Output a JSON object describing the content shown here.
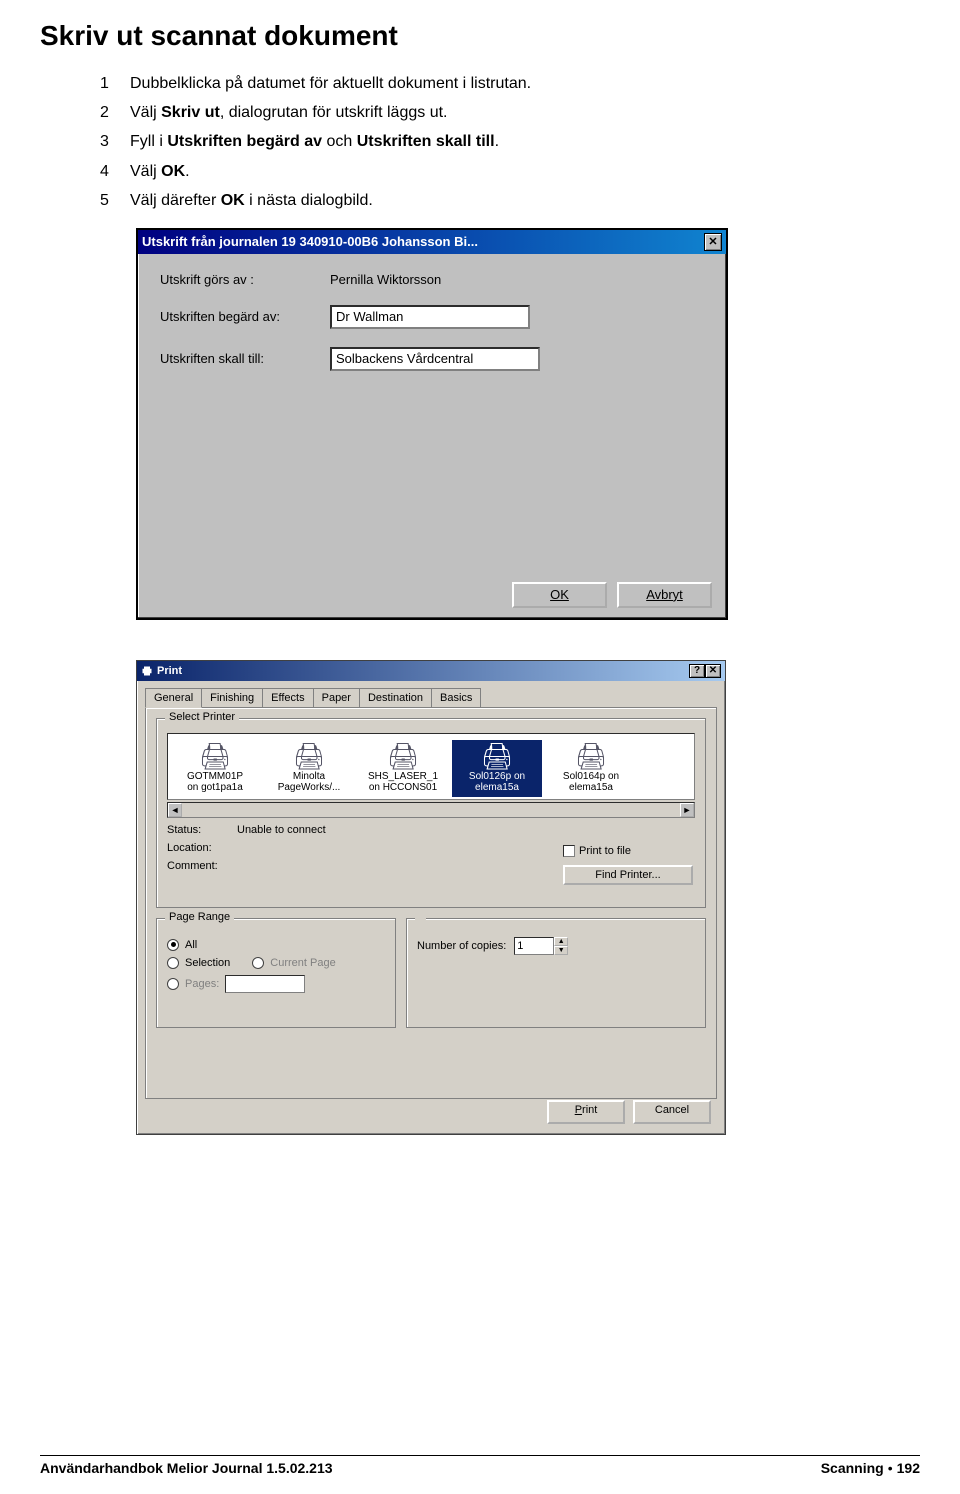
{
  "page": {
    "heading": "Skriv ut scannat dokument",
    "steps": [
      {
        "num": "1",
        "html": "Dubbelklicka på datumet för aktuellt dokument i listrutan.",
        "bold1": "",
        "post1": ""
      },
      {
        "num": "2",
        "pre": "Välj ",
        "b1": "Skriv ut",
        "post": ", dialogrutan för utskrift läggs ut."
      },
      {
        "num": "3",
        "pre": "Fyll i ",
        "b1": "Utskriften begärd av",
        "mid": " och ",
        "b2": "Utskriften skall till",
        "post": "."
      },
      {
        "num": "4",
        "pre": "Välj ",
        "b1": "OK",
        "post": "."
      },
      {
        "num": "5",
        "pre": "Välj därefter ",
        "b1": "OK",
        "post": " i nästa dialogbild."
      }
    ]
  },
  "dialog1": {
    "title": "Utskrift från journalen 19 340910-00B6 Johansson Bi...",
    "label_by": "Utskrift görs av :",
    "value_by": "Pernilla Wiktorsson",
    "label_req": "Utskriften begärd av:",
    "value_req": "Dr Wallman",
    "label_to": "Utskriften skall till:",
    "value_to": "Solbackens Vårdcentral",
    "ok": "OK",
    "cancel": "Avbryt"
  },
  "dialog2": {
    "title": "Print",
    "tabs": [
      "General",
      "Finishing",
      "Effects",
      "Paper",
      "Destination",
      "Basics"
    ],
    "group_select": "Select Printer",
    "printers": [
      {
        "line1": "GOTMM01P",
        "line2": "on got1pa1a"
      },
      {
        "line1": "Minolta",
        "line2": "PageWorks/..."
      },
      {
        "line1": "SHS_LASER_1",
        "line2": "on HCCONS01"
      },
      {
        "line1": "Sol0126p on",
        "line2": "elema15a",
        "selected": true
      },
      {
        "line1": "Sol0164p on",
        "line2": "elema15a"
      }
    ],
    "status_lbl": "Status:",
    "status_val": "Unable to connect",
    "location_lbl": "Location:",
    "comment_lbl": "Comment:",
    "print_to_file": "Print to file",
    "find_printer": "Find Printer...",
    "group_range": "Page Range",
    "radio_all": "All",
    "radio_selection": "Selection",
    "radio_current": "Current Page",
    "radio_pages": "Pages:",
    "copies_lbl": "Number of copies:",
    "copies_val": "1",
    "btn_print": "Print",
    "btn_cancel": "Cancel"
  },
  "footer": {
    "left": "Användarhandbok Melior Journal 1.5.02.213",
    "right_section": "Scanning",
    "right_page": "192"
  }
}
